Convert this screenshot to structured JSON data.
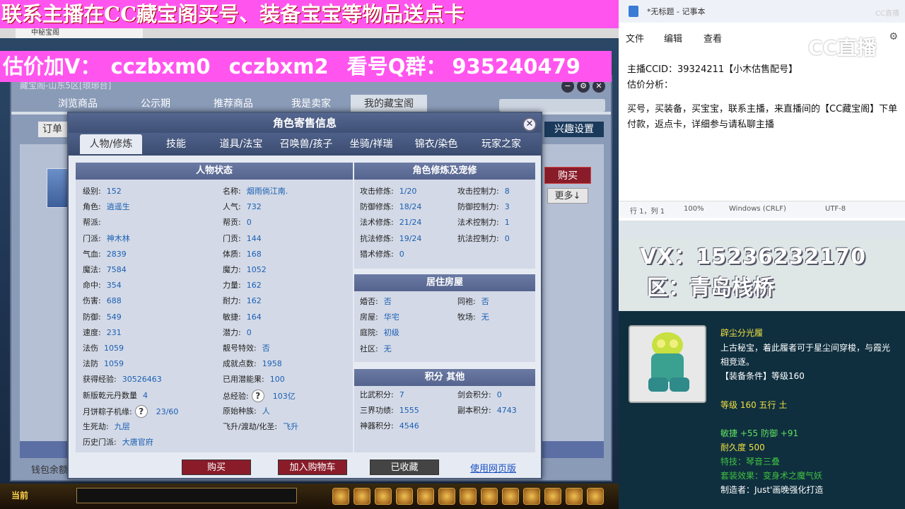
{
  "banner_top": "联系主播在CC藏宝阁买号、装备宝宝等物品送点卡",
  "browser_tab": "中秘宝阁",
  "banner_mid": [
    "估价加V：",
    "cczbxm0",
    "cczbxm2",
    "看号Q群：",
    "935240479"
  ],
  "shop": {
    "title": "藏宝阁-山东5区[琅琊台]",
    "tabs": [
      "浏览商品",
      "公示期",
      "推荐商品",
      "我是卖家",
      "我的藏宝阁"
    ],
    "order_label": "订单",
    "interest_button": "兴趣设置",
    "buy_button": "购买",
    "more_button": "更多↓",
    "wallet_label": "钱包余额"
  },
  "bottom": {
    "current_label": "当前"
  },
  "dialog": {
    "title": "角色寄售信息",
    "close": "✕",
    "tabs": [
      "人物/修炼",
      "技能",
      "道具/法宝",
      "召唤兽/孩子",
      "坐骑/祥瑞",
      "锦衣/染色",
      "玩家之家"
    ],
    "status_title": "人物状态",
    "status_left": [
      {
        "k": "级别:",
        "v": "152"
      },
      {
        "k": "角色:",
        "v": "逍遥生"
      },
      {
        "k": "帮派:",
        "v": ""
      },
      {
        "k": "门派:",
        "v": "神木林"
      },
      {
        "k": "气血:",
        "v": "2839"
      },
      {
        "k": "魔法:",
        "v": "7584"
      },
      {
        "k": "命中:",
        "v": "354"
      },
      {
        "k": "伤害:",
        "v": "688"
      },
      {
        "k": "防御:",
        "v": "549"
      },
      {
        "k": "速度:",
        "v": "231"
      },
      {
        "k": "法伤",
        "v": "1059"
      },
      {
        "k": "法防",
        "v": "1059"
      },
      {
        "k": "获得经验:",
        "v": "30526463"
      },
      {
        "k": "新版乾元丹数量",
        "v": "4"
      },
      {
        "k": "月饼粽子机缘:",
        "v": "23/60"
      },
      {
        "k": "生死劫:",
        "v": "九层"
      },
      {
        "k": "历史门派:",
        "v": "大唐官府"
      }
    ],
    "status_right": [
      {
        "k": "名称:",
        "v": "烟雨倘江南."
      },
      {
        "k": "人气:",
        "v": "732"
      },
      {
        "k": "帮贡:",
        "v": "0"
      },
      {
        "k": "门贡:",
        "v": "144"
      },
      {
        "k": "体质:",
        "v": "168"
      },
      {
        "k": "魔力:",
        "v": "1052"
      },
      {
        "k": "力量:",
        "v": "162"
      },
      {
        "k": "耐力:",
        "v": "162"
      },
      {
        "k": "敏捷:",
        "v": "164"
      },
      {
        "k": "潜力:",
        "v": "0"
      },
      {
        "k": "靓号特效:",
        "v": "否"
      },
      {
        "k": "成就点数:",
        "v": "1958"
      },
      {
        "k": "已用潜能果:",
        "v": "100"
      },
      {
        "k": "总经验:",
        "v": "103亿"
      },
      {
        "k": "原始种族:",
        "v": "人"
      },
      {
        "k": "飞升/渡劫/化圣:",
        "v": "飞升"
      }
    ],
    "cultivation_title": "角色修炼及宠修",
    "cultivation": [
      {
        "k": "攻击修炼:",
        "v": "1/20",
        "k2": "攻击控制力:",
        "v2": "8"
      },
      {
        "k": "防御修炼:",
        "v": "18/24",
        "k2": "防御控制力:",
        "v2": "3"
      },
      {
        "k": "法术修炼:",
        "v": "21/24",
        "k2": "法术控制力:",
        "v2": "1"
      },
      {
        "k": "抗法修炼:",
        "v": "19/24",
        "k2": "抗法控制力:",
        "v2": "0"
      },
      {
        "k": "猎术修炼:",
        "v": "0",
        "k2": "",
        "v2": ""
      }
    ],
    "house_title": "居住房屋",
    "house": [
      {
        "k": "婚否:",
        "v": "否",
        "k2": "同袍:",
        "v2": "否"
      },
      {
        "k": "房屋:",
        "v": "华宅",
        "k2": "牧场:",
        "v2": "无"
      },
      {
        "k": "庭院:",
        "v": "初级",
        "k2": "",
        "v2": ""
      },
      {
        "k": "社区:",
        "v": "无",
        "k2": "",
        "v2": ""
      }
    ],
    "points_title": "积分 其他",
    "points": [
      {
        "k": "比武积分:",
        "v": "7",
        "k2": "剑会积分:",
        "v2": "0"
      },
      {
        "k": "三界功绩:",
        "v": "1555",
        "k2": "副本积分:",
        "v2": "4743"
      },
      {
        "k": "神器积分:",
        "v": "4546",
        "k2": "",
        "v2": ""
      }
    ],
    "btn_buy": "购买",
    "btn_cart": "加入购物车",
    "btn_saved": "已收藏",
    "web_link": "使用网页版"
  },
  "notepad": {
    "title": "*无标题 - 记事本",
    "menu": [
      "文件",
      "编辑",
      "查看"
    ],
    "lines": [
      "主播CCID：39324211【小木估售配号】",
      "估价分析：",
      "",
      "买号，买装备，买宝宝，联系主播，来直播间的【CC藏宝阁】下单付款，返点卡，详细参与请私聊主播"
    ],
    "status": [
      "行 1，列 1",
      "100%",
      "Windows (CRLF)",
      "UTF-8"
    ],
    "logo": "CC直播"
  },
  "overlay": {
    "vx": "VX：15236232170",
    "qu": "区：青岛栈桥"
  },
  "item": {
    "name": "辟尘分光履",
    "desc": "上古秘宝，着此履者可于星尘间穿梭，与霞光相竞逐。",
    "cond": "【装备条件】等级160",
    "level": "等级 160 五行 土",
    "attrs": "敏捷 +55 防御 +91",
    "durability": "耐久度 500",
    "special": "特技：琴音三叠",
    "set": "套装效果：变身术之魔气妖",
    "maker": "制造者：Just'画晚强化打造"
  }
}
